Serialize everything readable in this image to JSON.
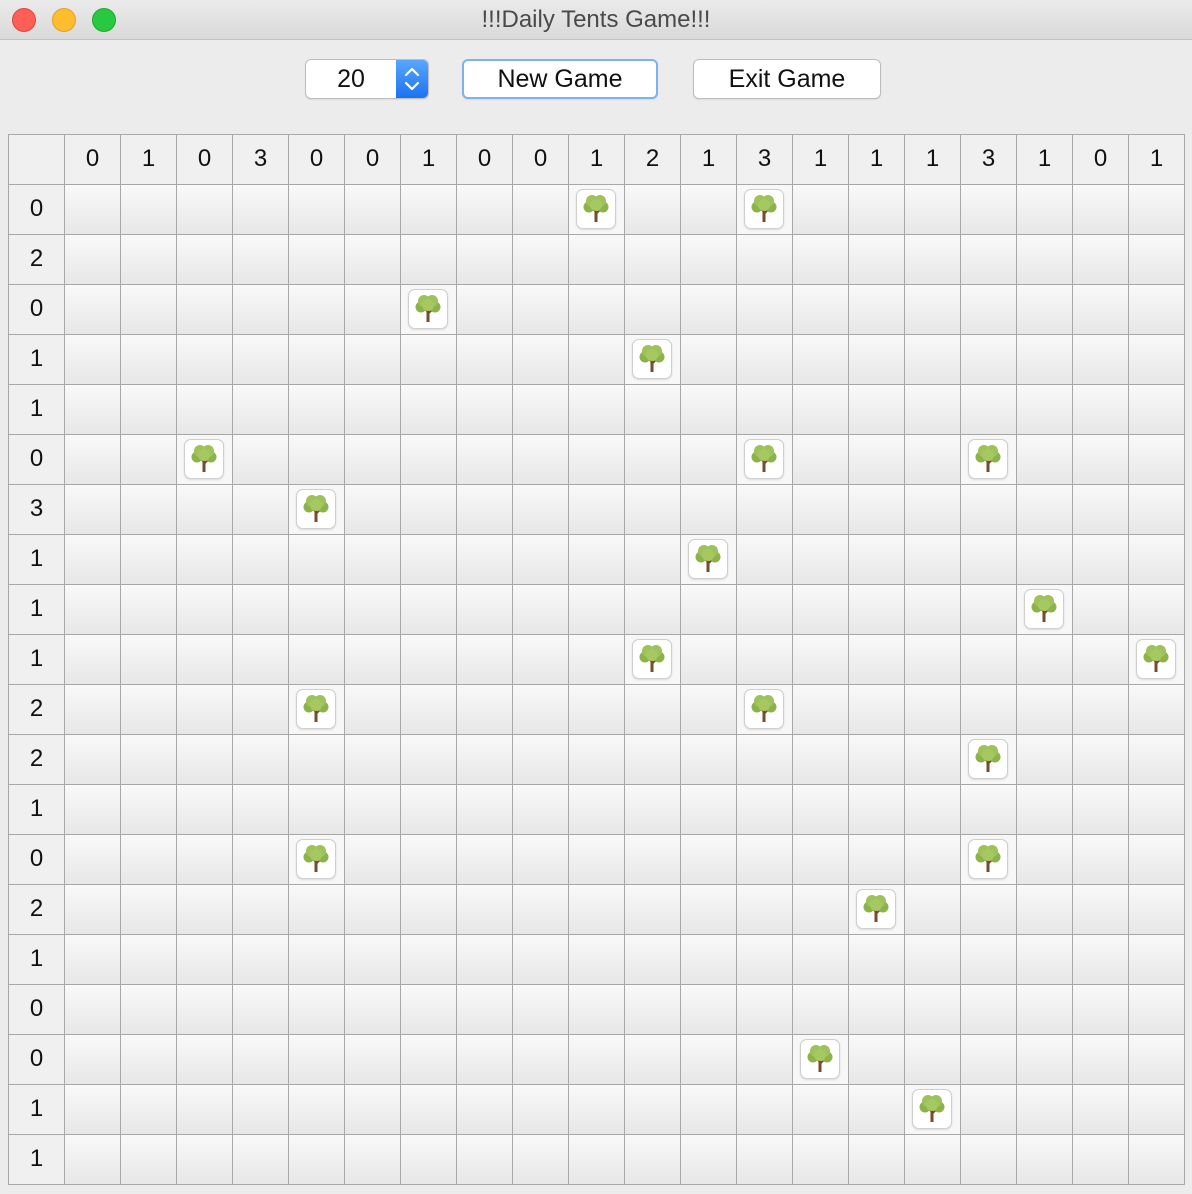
{
  "window": {
    "title": "!!!Daily Tents Game!!!"
  },
  "toolbar": {
    "size_value": "20",
    "new_game_label": "New Game",
    "exit_game_label": "Exit Game"
  },
  "board": {
    "column_clues": [
      "0",
      "1",
      "0",
      "3",
      "0",
      "0",
      "1",
      "0",
      "0",
      "1",
      "2",
      "1",
      "3",
      "1",
      "1",
      "1",
      "3",
      "1",
      "0",
      "1"
    ],
    "row_clues": [
      "0",
      "2",
      "0",
      "1",
      "1",
      "0",
      "3",
      "1",
      "1",
      "1",
      "2",
      "2",
      "1",
      "0",
      "2",
      "1",
      "0",
      "0",
      "1",
      "1"
    ],
    "trees": [
      [
        0,
        9
      ],
      [
        0,
        12
      ],
      [
        2,
        6
      ],
      [
        3,
        10
      ],
      [
        5,
        2
      ],
      [
        5,
        12
      ],
      [
        5,
        16
      ],
      [
        6,
        4
      ],
      [
        7,
        11
      ],
      [
        8,
        17
      ],
      [
        9,
        10
      ],
      [
        9,
        19
      ],
      [
        10,
        4
      ],
      [
        10,
        12
      ],
      [
        11,
        16
      ],
      [
        13,
        4
      ],
      [
        13,
        16
      ],
      [
        14,
        14
      ],
      [
        17,
        13
      ],
      [
        18,
        15
      ]
    ],
    "icon": "tree-icon"
  }
}
